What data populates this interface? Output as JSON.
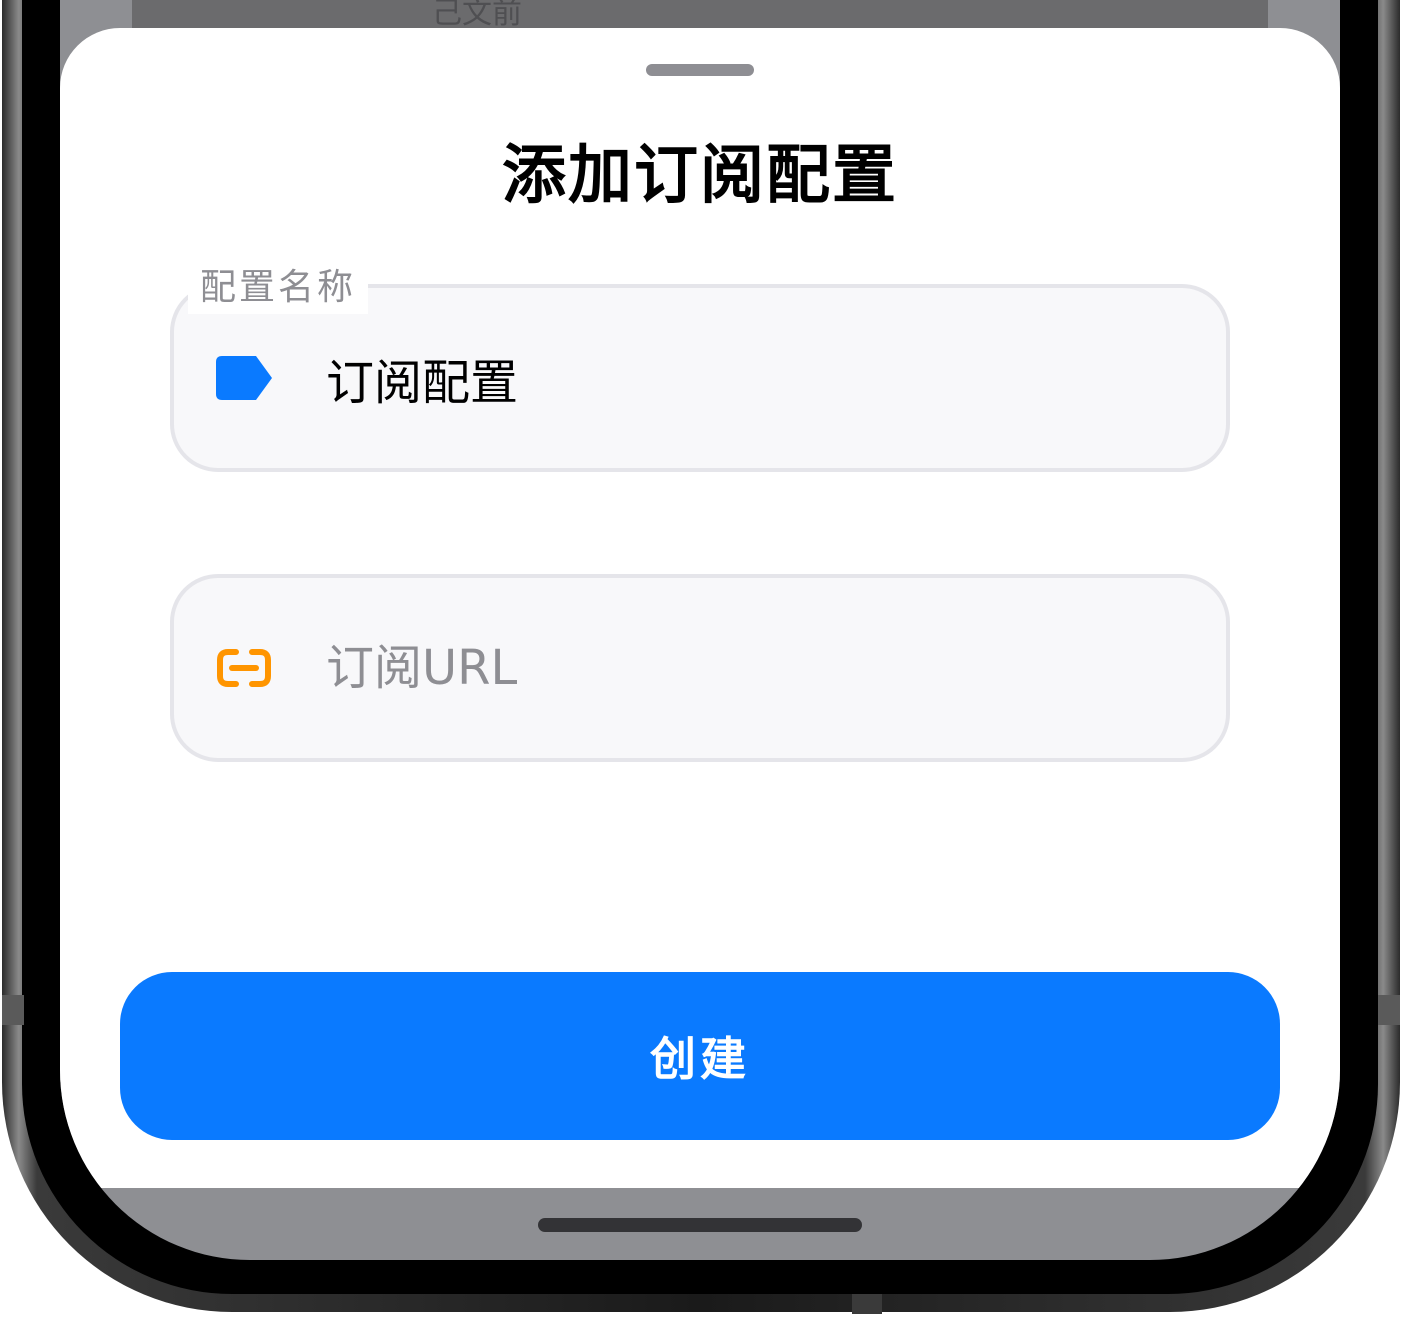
{
  "behind": {
    "partial_text": "己文前"
  },
  "sheet": {
    "title": "添加订阅配置"
  },
  "form": {
    "name_field": {
      "label": "配置名称",
      "value": "订阅配置",
      "icon": "tag-icon",
      "icon_color": "#0a7aff"
    },
    "url_field": {
      "placeholder": "订阅URL",
      "value": "",
      "icon": "link-icon",
      "icon_color": "#ff9500"
    }
  },
  "actions": {
    "create_label": "创建",
    "accent_color": "#0a7aff"
  }
}
